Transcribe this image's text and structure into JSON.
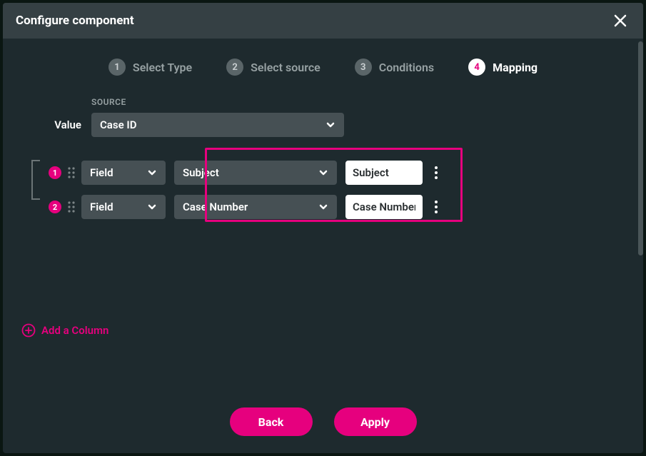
{
  "header": {
    "title": "Configure component"
  },
  "stepper": {
    "steps": [
      {
        "num": "1",
        "label": "Select Type"
      },
      {
        "num": "2",
        "label": "Select source"
      },
      {
        "num": "3",
        "label": "Conditions"
      },
      {
        "num": "4",
        "label": "Mapping"
      }
    ],
    "activeIndex": 3
  },
  "source": {
    "label": "SOURCE",
    "valueLabel": "Value",
    "valueSelected": "Case ID"
  },
  "rows": [
    {
      "badge": "1",
      "type": "Field",
      "field": "Subject",
      "alias": "Subject"
    },
    {
      "badge": "2",
      "type": "Field",
      "field": "Case Number",
      "alias": "Case Number"
    }
  ],
  "addColumn": "Add a Column",
  "footer": {
    "back": "Back",
    "apply": "Apply"
  }
}
